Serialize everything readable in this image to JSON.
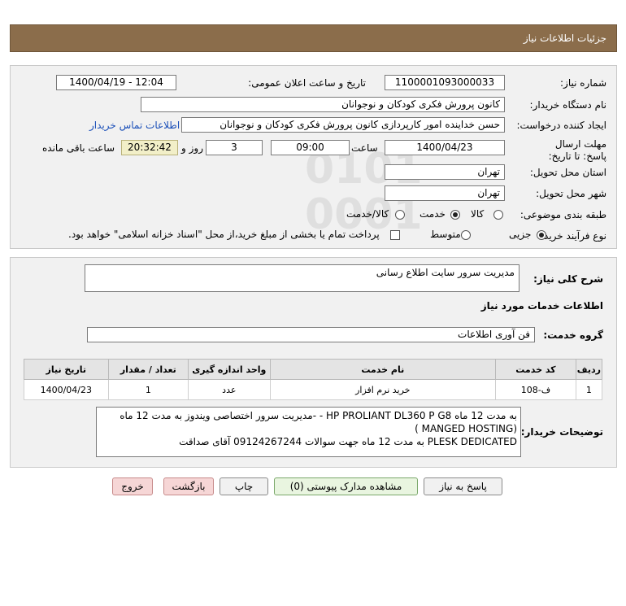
{
  "header": {
    "title": "جزئیات اطلاعات نیاز"
  },
  "form": {
    "need_number_label": "شماره نیاز:",
    "need_number": "1100001093000033",
    "announce_label": "تاریخ و ساعت اعلان عمومی:",
    "announce_value": "1400/04/19 - 12:04",
    "buyer_org_label": "نام دستگاه خریدار:",
    "buyer_org": "کانون پرورش فکری کودکان و نوجوانان",
    "creator_label": "ایجاد کننده درخواست:",
    "creator": "حسن خداینده امور کارپردازی  کانون پرورش فکری کودکان و نوجوانان",
    "contact_link": "اطلاعات تماس خریدار",
    "deadline_label": "مهلت ارسال پاسخ: تا تاریخ:",
    "deadline_date": "1400/04/23",
    "time_label": "ساعت",
    "deadline_time": "09:00",
    "days": "3",
    "days_label": "روز و",
    "remaining_time": "20:32:42",
    "remaining_label": "ساعت باقی مانده",
    "province_label": "استان محل تحویل:",
    "province": "تهران",
    "city_label": "شهر محل تحویل:",
    "city": "تهران",
    "category_label": "طبقه بندی موضوعی:",
    "category_options": [
      "کالا",
      "خدمت",
      "کالا/خدمت"
    ],
    "category_selected": "خدمت",
    "process_label": "نوع فرآیند خرید :",
    "process_options": [
      "جزیی",
      "متوسط"
    ],
    "process_selected": "جزیی",
    "payment_note": "پرداخت تمام یا بخشی از مبلغ خرید،از محل \"اسناد خزانه اسلامی\" خواهد بود."
  },
  "details": {
    "summary_label": "شرح کلی نیاز:",
    "summary": "مدیریت سرور سایت اطلاع رسانی",
    "services_heading": "اطلاعات خدمات مورد نیاز",
    "service_group_label": "گروه خدمت:",
    "service_group": "فن آوری اطلاعات",
    "table": {
      "headers": [
        "ردیف",
        "کد خدمت",
        "نام خدمت",
        "واحد اندازه گیری",
        "تعداد / مقدار",
        "تاریخ نیاز"
      ],
      "rows": [
        [
          "1",
          "ف-108",
          "خرید نرم افزار",
          "عدد",
          "1",
          "1400/04/23"
        ]
      ]
    },
    "buyer_notes_label": "توضیحات خریدار:",
    "buyer_notes": "به مدت 12 ماه    HP PROLIANT DL360 P G8  -  -مدیریت سرور اختصاصی ویندوز به مدت 12 ماه\n(MANGED HOSTING )\nPLESK DEDICATED  به مدت 12 ماه   جهت سوالات 09124267244 آقای صداقت"
  },
  "buttons": {
    "reply": "پاسخ به نیاز",
    "attachments": "مشاهده مدارک پیوستی (0)",
    "print": "چاپ",
    "back": "بازگشت",
    "exit": "خروج"
  }
}
